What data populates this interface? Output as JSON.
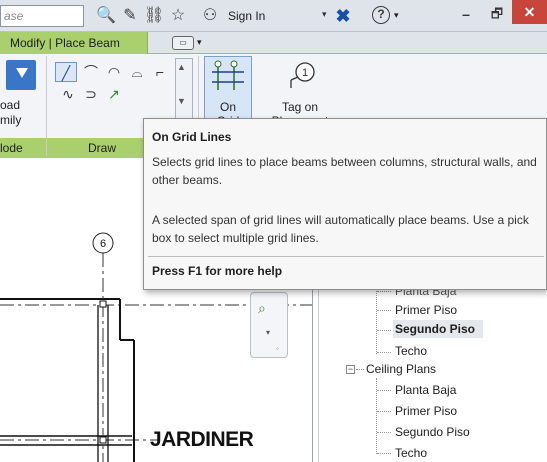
{
  "titlebar": {
    "search_placeholder": "ase",
    "sign_in_label": "Sign In",
    "icons": [
      "binoculars-icon",
      "search-people-icon",
      "subscription-icon",
      "favorites-star-icon",
      "user-icon",
      "exchange-icon",
      "help-icon"
    ]
  },
  "window_controls": {
    "minimize": "–",
    "maximize": "🗗",
    "close": "✕"
  },
  "ribbon": {
    "active_tab": "Modify | Place Beam",
    "mode_panel": {
      "label": "lode",
      "load_family_label": "oad\nmily"
    },
    "draw_panel": {
      "label": "Draw"
    },
    "on_grid_button": {
      "label": "On\nGrid"
    },
    "tag_button": {
      "label": "Tag on\nPlacement"
    }
  },
  "tooltip": {
    "title": "On Grid Lines",
    "description": "Selects grid lines to place beams between columns, structural walls, and other beams.",
    "detail": "A selected span of grid lines will automatically place beams. Use a pick box to select multiple grid lines.",
    "help": "Press F1 for more help"
  },
  "canvas": {
    "grid_bubble": "6",
    "room_label": "JARDINER"
  },
  "browser": {
    "floor_plans": [
      "Planta Baja",
      "Primer Piso",
      "Segundo Piso",
      "Techo"
    ],
    "selected_view": "Segundo Piso",
    "ceiling_plans_label": "Ceiling Plans",
    "ceiling_plans": [
      "Planta Baja",
      "Primer Piso",
      "Segundo Piso",
      "Techo"
    ]
  }
}
